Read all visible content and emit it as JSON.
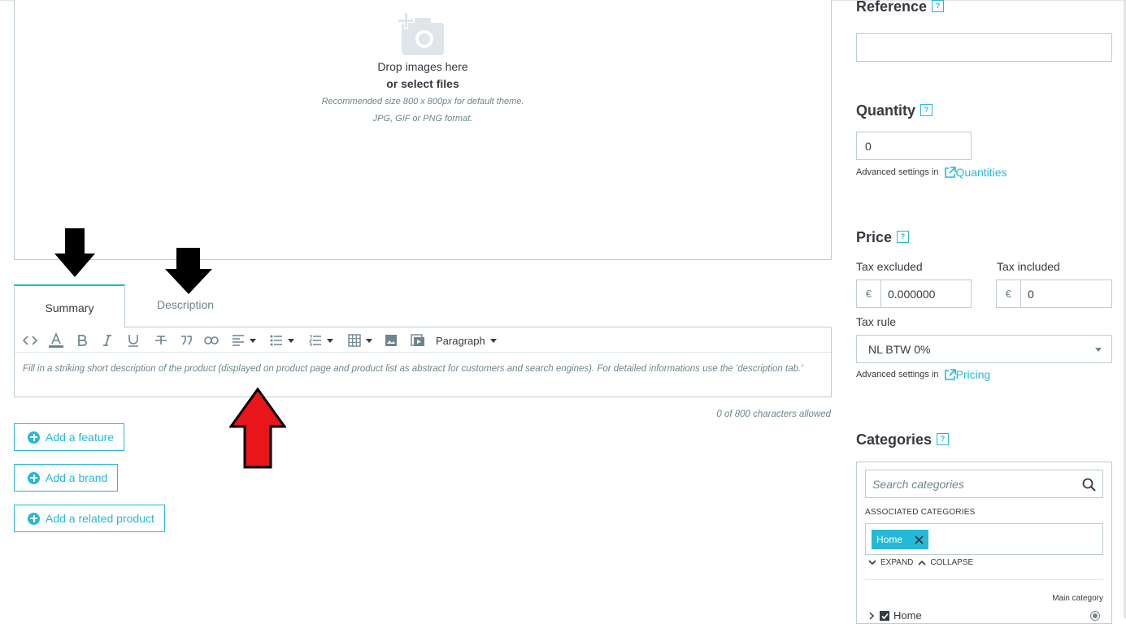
{
  "dropzone": {
    "drop_text": "Drop images here",
    "select_files": "or select files",
    "recommended_size": "Recommended size 800 x 800px for default theme.",
    "formats": "JPG, GIF or PNG format."
  },
  "tabs": [
    {
      "label": "Summary",
      "active": true
    },
    {
      "label": "Description",
      "active": false
    }
  ],
  "editor": {
    "toolbar": {
      "paragraph_select": "Paragraph",
      "icons": [
        "code-icon",
        "font-color-icon",
        "bold-icon",
        "italic-icon",
        "underline-icon",
        "strikethrough-icon",
        "blockquote-icon",
        "link-icon",
        "align-icon",
        "bullet-list-icon",
        "numbered-list-icon",
        "table-icon",
        "image-icon",
        "media-icon"
      ]
    },
    "placeholder": "Fill in a striking short description of the product (displayed on product page and product list as abstract for customers and search engines). For detailed informations use the 'description tab.'",
    "char_count": "0 of 800 characters allowed"
  },
  "actions": {
    "add_feature": "Add a feature",
    "add_brand": "Add a brand",
    "add_related": "Add a related product"
  },
  "reference": {
    "title": "Reference",
    "help": "?",
    "value": ""
  },
  "quantity": {
    "title": "Quantity",
    "help": "?",
    "value": "0",
    "advanced_prefix": "Advanced settings in",
    "advanced_link": "Quantities"
  },
  "price": {
    "title": "Price",
    "help": "?",
    "tax_excluded_label": "Tax excluded",
    "tax_included_label": "Tax included",
    "currency": "€",
    "tax_excluded_value": "0.000000",
    "tax_included_value": "0",
    "tax_rule_label": "Tax rule",
    "tax_rule_value": "NL BTW 0%",
    "advanced_prefix": "Advanced settings in",
    "advanced_link": "Pricing"
  },
  "categories": {
    "title": "Categories",
    "help": "?",
    "search_placeholder": "Search categories",
    "associated_label": "ASSOCIATED CATEGORIES",
    "tag": "Home",
    "expand": "EXPAND",
    "collapse": "COLLAPSE",
    "main_category_label": "Main category",
    "tree_item": "Home"
  },
  "colors": {
    "accent": "#25b9d7",
    "border": "#bbcdd2",
    "annotation_black": "#000000",
    "annotation_red": "#e8151b"
  }
}
